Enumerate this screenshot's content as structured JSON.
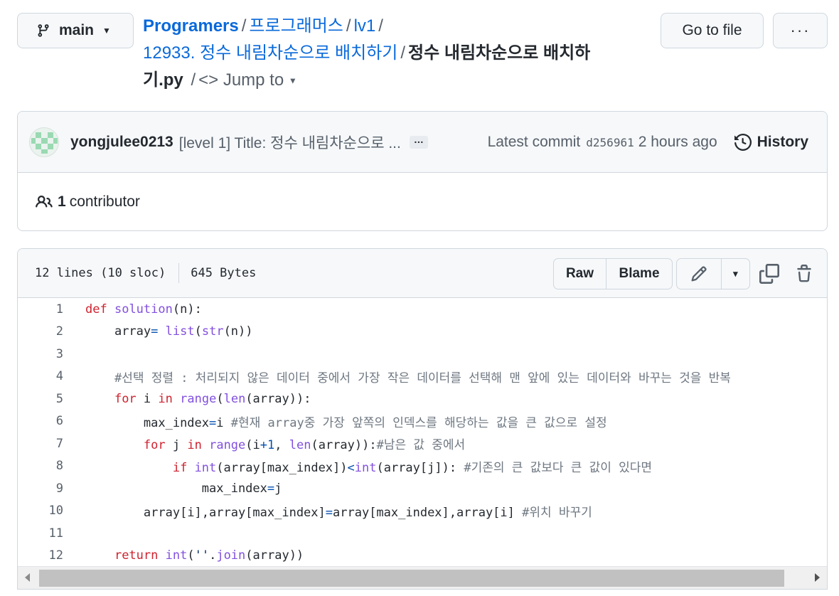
{
  "branch": {
    "label": "main"
  },
  "breadcrumb": {
    "root": "Programers",
    "parts": [
      "프로그래머스",
      "lv1",
      "12933. 정수 내림차순으로 배치하기"
    ],
    "file_line1": "정수 내림차순으로 배치하",
    "file_line2": "기.py",
    "jump": "Jump to"
  },
  "actions": {
    "goto_file": "Go to file",
    "more": "···"
  },
  "commit": {
    "author": "yongjulee0213",
    "message": "[level 1] Title: 정수 내림차순으로 ...",
    "ellipsis": "…",
    "latest_label": "Latest commit",
    "sha": "d256961",
    "time": "2 hours ago",
    "history": "History"
  },
  "contributors": {
    "count": "1",
    "label": "contributor"
  },
  "file": {
    "lines_info": "12 lines (10 sloc)",
    "size": "645 Bytes",
    "raw": "Raw",
    "blame": "Blame"
  },
  "code": {
    "line_numbers": [
      "1",
      "2",
      "3",
      "4",
      "5",
      "6",
      "7",
      "8",
      "9",
      "10",
      "11",
      "12"
    ],
    "l1": [
      "def",
      "solution",
      "(n):"
    ],
    "l2": [
      "array",
      "=",
      "list",
      "str",
      "(n))"
    ],
    "l4": "#선택 정렬 : 처리되지 않은 데이터 중에서 가장 작은 데이터를 선택해 맨 앞에 있는 데이터와 바꾸는 것을 반복",
    "l5": [
      "for",
      "i",
      "in",
      "range",
      "len",
      "(array)):"
    ],
    "l6": [
      "max_index",
      "=",
      "i",
      "#현재 array중 가장 앞쪽의 인덱스를 해당하는 값을 큰 값으로 설정"
    ],
    "l7": [
      "for",
      "j",
      "in",
      "range",
      "(i",
      "+",
      "1",
      ",",
      "len",
      "(array)):",
      "#남은 값 중에서"
    ],
    "l8": [
      "if",
      "int",
      "(array[max_index])",
      "<",
      "int",
      "(array[j]):",
      "#기존의 큰 값보다 큰 값이 있다면"
    ],
    "l9": [
      "max_index",
      "=",
      "j"
    ],
    "l10": [
      "array[i],array[max_index]",
      "=",
      "array[max_index],array[i]",
      "#위치 바꾸기"
    ],
    "l12": [
      "return",
      "int",
      "(",
      "''",
      ".",
      "join",
      "(array))"
    ]
  },
  "colors": {
    "link": "#0969da",
    "keyword": "#cf222e",
    "function": "#8250df",
    "comment": "#6e7781",
    "number": "#0550ae"
  }
}
